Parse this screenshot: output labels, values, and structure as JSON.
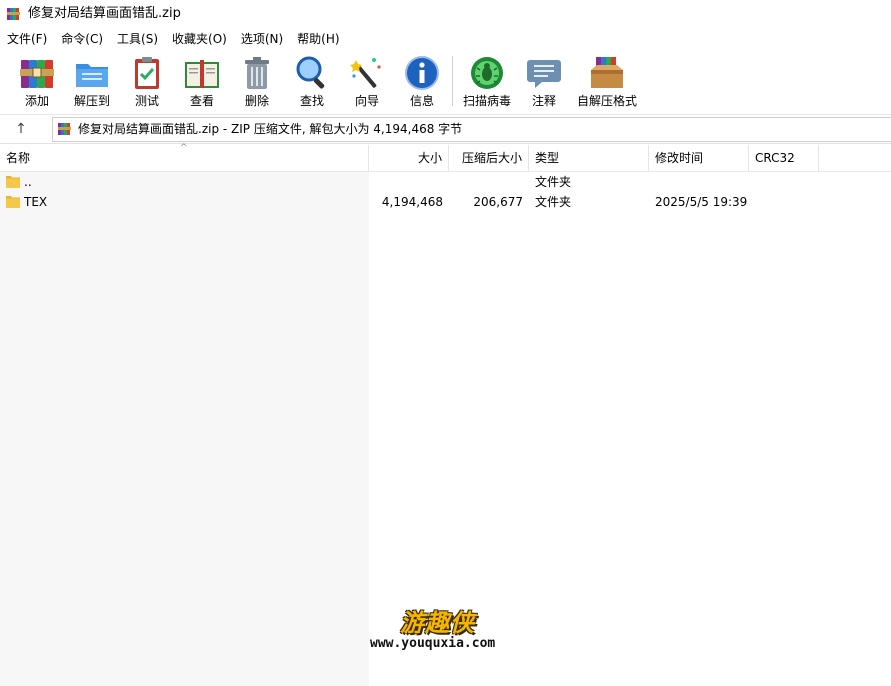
{
  "window": {
    "title": "修复对局结算画面错乱.zip"
  },
  "menu": [
    {
      "label": "文件(F)"
    },
    {
      "label": "命令(C)"
    },
    {
      "label": "工具(S)"
    },
    {
      "label": "收藏夹(O)"
    },
    {
      "label": "选项(N)"
    },
    {
      "label": "帮助(H)"
    }
  ],
  "toolbar": {
    "add": "添加",
    "extract": "解压到",
    "test": "测试",
    "view": "查看",
    "delete": "删除",
    "find": "查找",
    "wizard": "向导",
    "info": "信息",
    "scan": "扫描病毒",
    "comment": "注释",
    "sfx": "自解压格式"
  },
  "address": {
    "path": "修复对局结算画面错乱.zip - ZIP 压缩文件, 解包大小为 4,194,468 字节"
  },
  "columns": {
    "name": "名称",
    "size": "大小",
    "packed": "压缩后大小",
    "type": "类型",
    "modified": "修改时间",
    "crc": "CRC32"
  },
  "rows": [
    {
      "name": "..",
      "size": "",
      "packed": "",
      "type": "文件夹",
      "modified": "",
      "crc": ""
    },
    {
      "name": "TEX",
      "size": "4,194,468",
      "packed": "206,677",
      "type": "文件夹",
      "modified": "2025/5/5 19:39",
      "crc": ""
    }
  ],
  "watermark": {
    "logo": "游趣侠",
    "url": "www.youquxia.com"
  },
  "colors": {
    "folder": "#f5c84a",
    "accent": "#0b6fc7"
  }
}
